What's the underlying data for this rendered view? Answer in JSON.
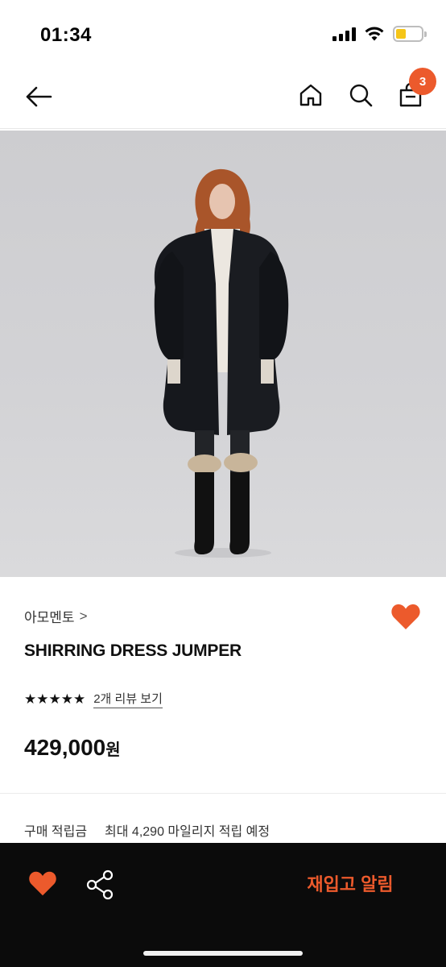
{
  "status_bar": {
    "time": "01:34",
    "battery_color": "#f5c518"
  },
  "nav": {
    "back_icon": "arrow-left-icon",
    "home_icon": "home-icon",
    "search_icon": "search-icon",
    "cart_icon": "shopping-bag-icon",
    "cart_count": "3"
  },
  "product": {
    "brand": "아모멘토",
    "brand_chevron": ">",
    "name": "SHIRRING DRESS JUMPER",
    "stars": "★★★★★",
    "review_link": "2개 리뷰 보기",
    "price_value": "429,000",
    "price_unit": "원",
    "wishlisted": true
  },
  "points": {
    "label": "구매 적립금",
    "value": "최대 4,290 마일리지 적립 예정"
  },
  "bottom_bar": {
    "heart_icon": "heart-icon",
    "share_icon": "share-icon",
    "restock_label": "재입고 알림"
  },
  "colors": {
    "accent": "#ec5a2c",
    "bottom_bar": "#0b0b0b"
  }
}
